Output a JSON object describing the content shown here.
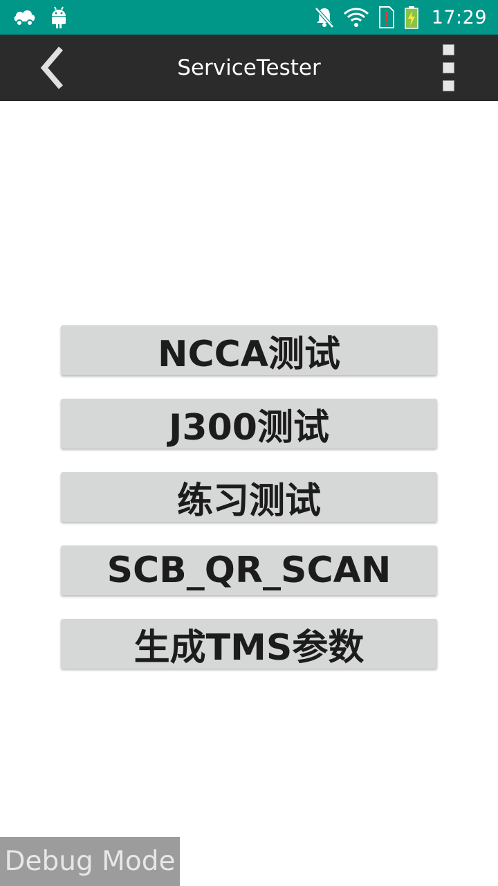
{
  "status_bar": {
    "time": "17:29",
    "background_color": "#009688",
    "left_icons": [
      "cloud-car-icon",
      "android-icon"
    ],
    "right_icons": [
      "notifications-off-icon",
      "wifi-icon",
      "sim-alert-icon",
      "battery-charging-icon"
    ]
  },
  "app_bar": {
    "title": "ServiceTester",
    "background_color": "#2b2b2b",
    "back_icon": "chevron-left-icon",
    "menu_icon": "overflow-menu-icon"
  },
  "buttons": [
    {
      "label": "NCCA测试"
    },
    {
      "label": "J300测试"
    },
    {
      "label": "练习测试"
    },
    {
      "label": "SCB_QR_SCAN"
    },
    {
      "label": "生成TMS参数"
    }
  ],
  "debug_label": "Debug Mode"
}
